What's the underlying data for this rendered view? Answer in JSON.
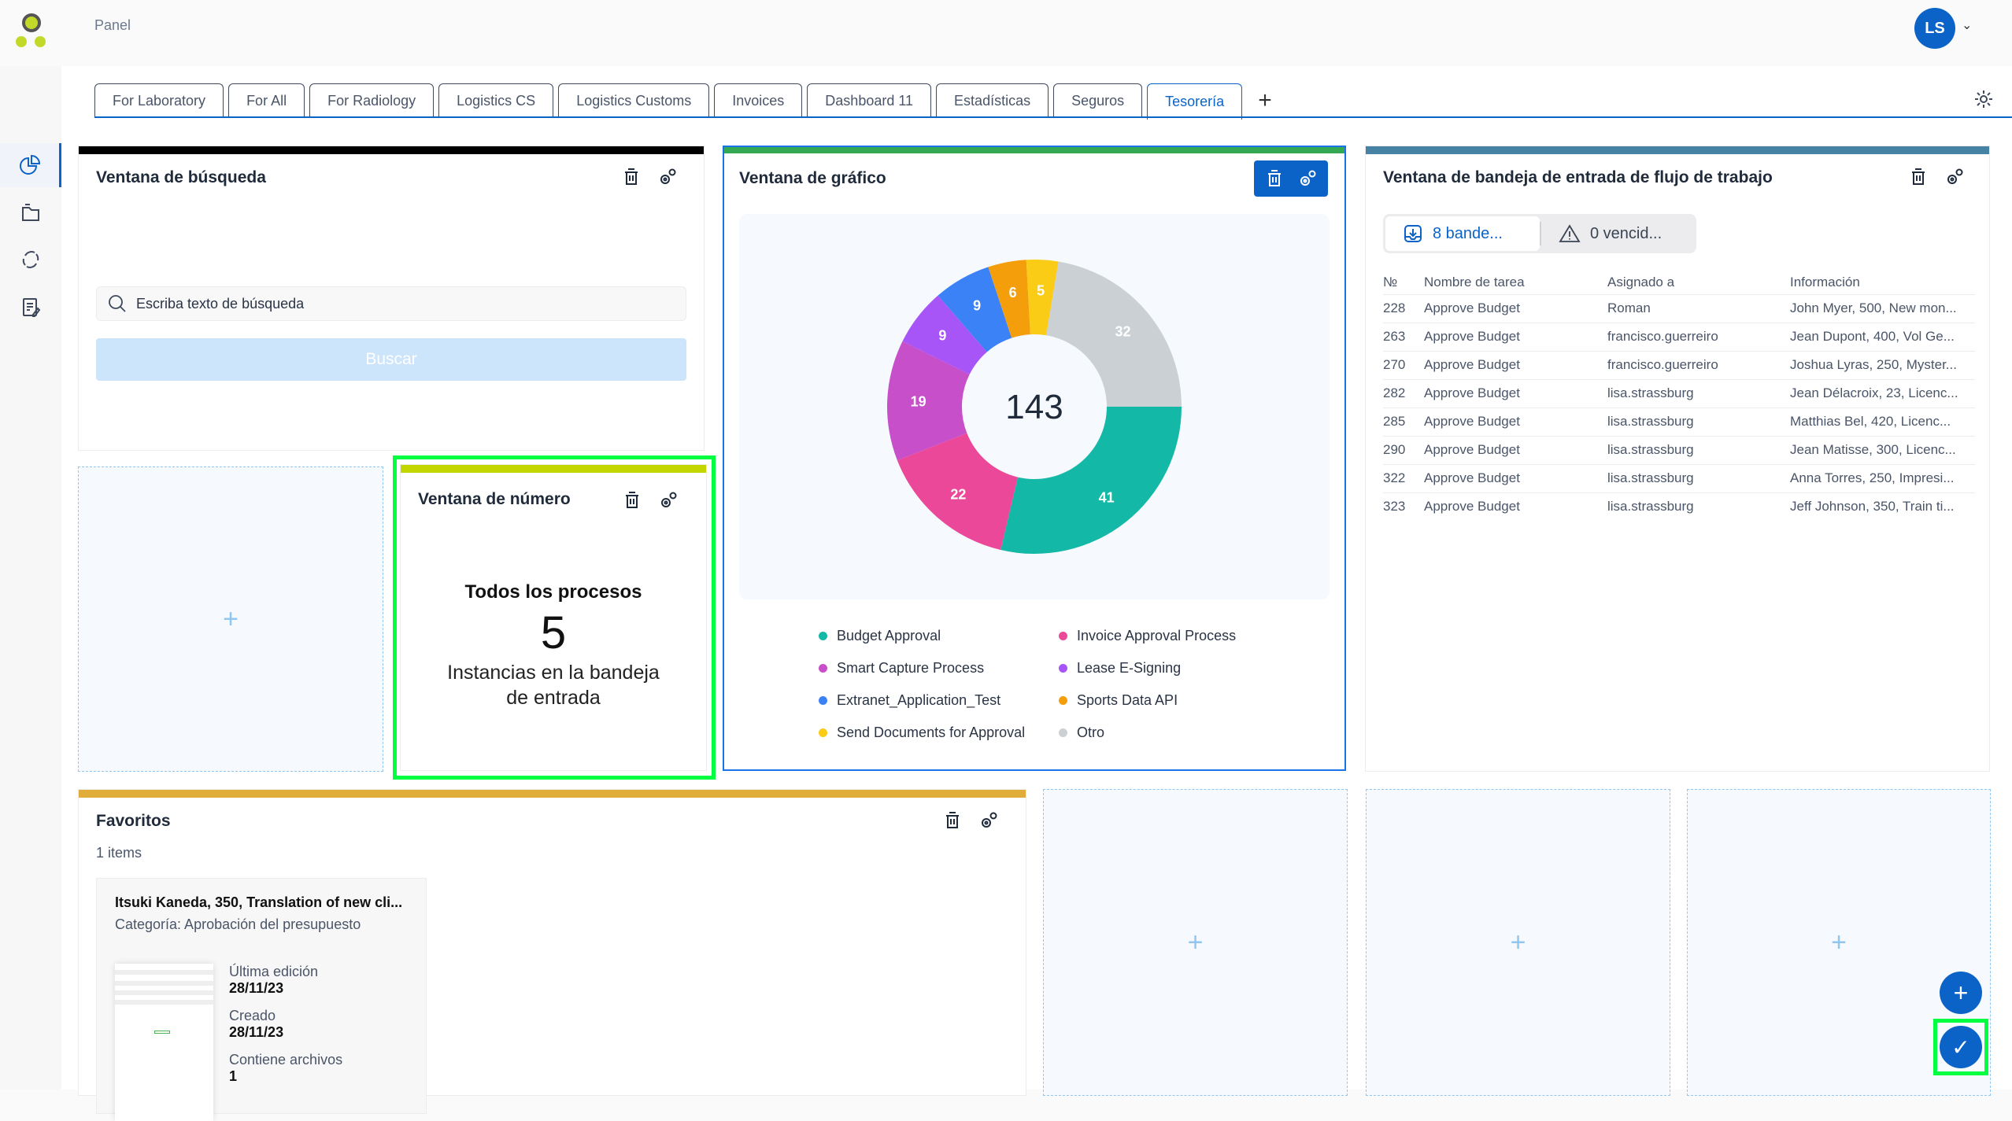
{
  "header": {
    "title": "Panel",
    "user_initials": "LS"
  },
  "sidebar": {
    "items": [
      {
        "name": "dashboard",
        "icon": "pie-chart-icon",
        "active": true
      },
      {
        "name": "documents",
        "icon": "folder-icon",
        "active": false
      },
      {
        "name": "workflows",
        "icon": "refresh-cycle-icon",
        "active": false
      },
      {
        "name": "tasks",
        "icon": "clipboard-edit-icon",
        "active": false
      }
    ]
  },
  "tabs": [
    {
      "label": "For Laboratory",
      "active": false
    },
    {
      "label": "For All",
      "active": false
    },
    {
      "label": "For Radiology",
      "active": false
    },
    {
      "label": "Logistics CS",
      "active": false
    },
    {
      "label": "Logistics Customs",
      "active": false
    },
    {
      "label": "Invoices",
      "active": false
    },
    {
      "label": "Dashboard 11",
      "active": false
    },
    {
      "label": "Estadísticas",
      "active": false
    },
    {
      "label": "Seguros",
      "active": false
    },
    {
      "label": "Tesorería",
      "active": true
    }
  ],
  "tab_add_label": "+",
  "colors": {
    "accent": "#0b63c8",
    "search_bar": "#000000",
    "chart_bar": "#34a853",
    "inbox_bar": "#4582a3",
    "number_bar": "#c3d600",
    "favorites_bar": "#e0ac3a",
    "highlight": "#00ff40"
  },
  "search_widget": {
    "title": "Ventana de búsqueda",
    "placeholder": "Escriba texto de búsqueda",
    "button_label": "Buscar"
  },
  "number_widget": {
    "title": "Ventana de número",
    "heading": "Todos los procesos",
    "value": "5",
    "caption_line1": "Instancias en la bandeja",
    "caption_line2": "de entrada"
  },
  "chart_widget": {
    "title": "Ventana de gráfico"
  },
  "chart_data": {
    "type": "pie",
    "variant": "donut",
    "title": "Ventana de gráfico",
    "center_label": "143",
    "categories": [
      "Budget Approval",
      "Invoice Approval Process",
      "Smart Capture Process",
      "Lease E-Signing",
      "Extranet_Application_Test",
      "Sports Data API",
      "Send Documents for Approval",
      "Otro"
    ],
    "values": [
      41,
      22,
      19,
      9,
      9,
      6,
      5,
      32
    ],
    "colors": [
      "#14b8a6",
      "#ec4899",
      "#c74fc9",
      "#a855f7",
      "#3b82f6",
      "#f59e0b",
      "#facc15",
      "#cbd0d5"
    ],
    "total": 143,
    "legend_position": "bottom"
  },
  "inbox_widget": {
    "title": "Ventana de bandeja de entrada de flujo de trabajo",
    "toggle_inbox_label": "8 bande...",
    "toggle_overdue_label": "0 vencid...",
    "columns": [
      "№",
      "Nombre de tarea",
      "Asignado a",
      "Información"
    ],
    "rows": [
      [
        "228",
        "Approve Budget",
        "Roman",
        "John Myer, 500, New mon..."
      ],
      [
        "263",
        "Approve Budget",
        "francisco.guerreiro",
        "Jean Dupont, 400, Vol Ge..."
      ],
      [
        "270",
        "Approve Budget",
        "francisco.guerreiro",
        "Joshua Lyras, 250, Myster..."
      ],
      [
        "282",
        "Approve Budget",
        "lisa.strassburg",
        "Jean Délacroix, 23, Licenc..."
      ],
      [
        "285",
        "Approve Budget",
        "lisa.strassburg",
        "Matthias Bel, 420, Licenc..."
      ],
      [
        "290",
        "Approve Budget",
        "lisa.strassburg",
        "Jean Matisse, 300, Licenc..."
      ],
      [
        "322",
        "Approve Budget",
        "lisa.strassburg",
        "Anna Torres, 250, Impresi..."
      ],
      [
        "323",
        "Approve Budget",
        "lisa.strassburg",
        "Jeff Johnson, 350, Train ti..."
      ]
    ]
  },
  "favorites_widget": {
    "title": "Favoritos",
    "count_label": "1 items",
    "card": {
      "title": "Itsuki Kaneda, 350, Translation of new cli...",
      "category": "Categoría: Aprobación del presupuesto",
      "last_edit_label": "Última edición",
      "last_edit_value": "28/11/23",
      "created_label": "Creado",
      "created_value": "28/11/23",
      "files_label": "Contiene archivos",
      "files_value": "1"
    }
  },
  "empty_tile_label": "+",
  "fab": {
    "add_label": "+",
    "confirm_label": "✓"
  }
}
